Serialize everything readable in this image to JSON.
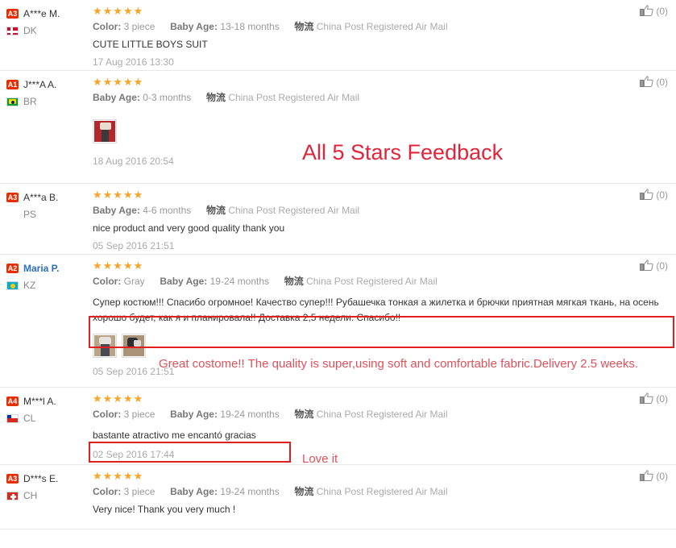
{
  "labels": {
    "color_key": "Color:",
    "baby_age_key": "Baby Age:",
    "logistics_cn": "物流",
    "stars": "★★★★★"
  },
  "reviews": [
    {
      "level": "A3",
      "name": "A***e M.",
      "name_is_link": false,
      "country": "DK",
      "flag_class": "flag-dk",
      "stars": "★★★★★",
      "color_key": "Color:",
      "color_val": "3 piece",
      "age_key": "Baby Age:",
      "age_val": "13-18 months",
      "logistics_cn": "物流",
      "logistics": "China Post Registered Air Mail",
      "comment": "CUTE LITTLE BOYS SUIT",
      "date": "17 Aug 2016 13:30",
      "helpful": "(0)",
      "images": []
    },
    {
      "level": "A1",
      "name": "J***A A.",
      "name_is_link": false,
      "country": "BR",
      "flag_class": "flag-br",
      "stars": "★★★★★",
      "color_key": "",
      "color_val": "",
      "age_key": "Baby Age:",
      "age_val": "0-3 months",
      "logistics_cn": "物流",
      "logistics": "China Post Registered Air Mail",
      "comment": "",
      "date": "18 Aug 2016 20:54",
      "helpful": "(0)",
      "images": [
        "th-red"
      ]
    },
    {
      "level": "A3",
      "name": "A***a B.",
      "name_is_link": false,
      "country": "PS",
      "flag_class": "none",
      "stars": "★★★★★",
      "color_key": "",
      "color_val": "",
      "age_key": "Baby Age:",
      "age_val": "4-6 months",
      "logistics_cn": "物流",
      "logistics": "China Post Registered Air Mail",
      "comment": "nice product and very good quality thank you",
      "date": "05 Sep 2016 21:51",
      "helpful": "(0)",
      "images": []
    },
    {
      "level": "A2",
      "name": "Maria P.",
      "name_is_link": true,
      "country": "KZ",
      "flag_class": "flag-kz",
      "stars": "★★★★★",
      "color_key": "Color:",
      "color_val": "Gray",
      "age_key": "Baby Age:",
      "age_val": "19-24 months",
      "logistics_cn": "物流",
      "logistics": "China Post Registered Air Mail",
      "comment": "Супер костюм!!! Спасибо огромное! Качество супер!!! Рубашечка тонкая а жилетка и брючки приятная мягкая ткань, на осень хорошо будет, как я и планировала!! Доставка 2,5 недели. Спасибо!!",
      "date": "05 Sep 2016 21:51",
      "helpful": "(0)",
      "images": [
        "th-beige1",
        "th-beige2"
      ]
    },
    {
      "level": "A4",
      "name": "M***l A.",
      "name_is_link": false,
      "country": "CL",
      "flag_class": "flag-cl",
      "stars": "★★★★★",
      "color_key": "Color:",
      "color_val": "3 piece",
      "age_key": "Baby Age:",
      "age_val": "19-24 months",
      "logistics_cn": "物流",
      "logistics": "China Post Registered Air Mail",
      "comment": "bastante atractivo me encantó gracias",
      "date": "02 Sep 2016 17:44",
      "helpful": "(0)",
      "images": []
    },
    {
      "level": "A3",
      "name": "D***s E.",
      "name_is_link": false,
      "country": "CH",
      "flag_class": "flag-ch",
      "stars": "★★★★★",
      "color_key": "Color:",
      "color_val": "3 piece",
      "age_key": "Baby Age:",
      "age_val": "19-24 months",
      "logistics_cn": "物流",
      "logistics": "China Post Registered Air Mail",
      "comment": "Very nice! Thank you very much !",
      "date": "",
      "helpful": "(0)",
      "images": []
    }
  ],
  "annotations": {
    "headline": "All 5 Stars Feedback",
    "maria_translation": "Great costome!! The quality is super,using soft and comfortable fabric.Delivery 2.5 weeks.",
    "love_it": "Love it"
  },
  "colors": {
    "annotation_red": "#e0243a",
    "box_red": "#e02020",
    "star_orange": "#f7a429",
    "level_badge": "#e62e04",
    "link_blue": "#2b6ec2"
  }
}
